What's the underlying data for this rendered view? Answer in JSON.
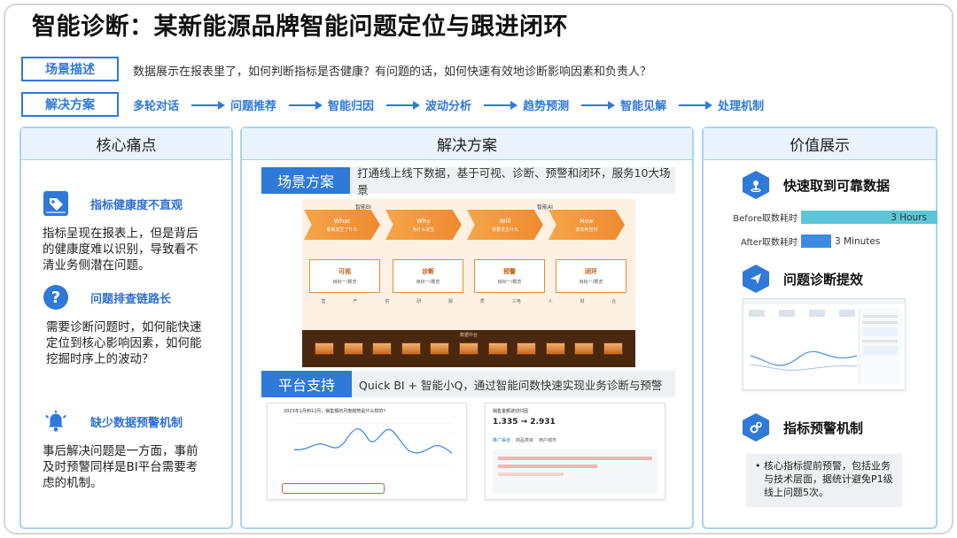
{
  "title": "智能诊断：某新能源品牌智能问题定位与跟进闭环",
  "scene": {
    "label": "场景描述",
    "text": "数据展示在报表里了，如何判断指标是否健康？有问题的话，如何快速有效地诊断影响因素和负责人？"
  },
  "solution_flow": {
    "label": "解决方案",
    "steps": [
      "多轮对话",
      "问题推荐",
      "智能归因",
      "波动分析",
      "趋势预测",
      "智能见解",
      "处理机制"
    ]
  },
  "left_panel": {
    "header": "核心痛点",
    "items": [
      {
        "icon": "tag-icon",
        "title": "指标健康度不直观",
        "desc": "指标呈现在报表上，但是背后的健康度难以识别，导致看不清业务侧潜在问题。"
      },
      {
        "icon": "question-icon",
        "title": "问题排查链路长",
        "desc": "需要诊断问题时，如何能快速定位到核心影响因素，如何能挖掘时序上的波动？"
      },
      {
        "icon": "bell-icon",
        "title": "缺少数据预警机制",
        "desc": "事后解决问题是一方面，事前及时预警同样是BI平台需要考虑的机制。"
      }
    ]
  },
  "middle_panel": {
    "header": "解决方案",
    "scene_band": {
      "label": "场景方案",
      "text": "打通线上线下数据，基于可视、诊断、预警和闭环，服务10大场景"
    },
    "scene_image": {
      "header_left": "智能BI",
      "header_right": "智能AI",
      "chevrons": [
        {
          "title": "What",
          "sub": "看到发生了什么"
        },
        {
          "title": "Why",
          "sub": "为什么发生"
        },
        {
          "title": "Will",
          "sub": "将要发生什么"
        },
        {
          "title": "How",
          "sub": "该如何应对"
        }
      ],
      "boxes": [
        {
          "title": "可视",
          "sub": "目标一/概览"
        },
        {
          "title": "诊断",
          "sub": "目标一/概览"
        },
        {
          "title": "预警",
          "sub": "目标一/概览"
        },
        {
          "title": "闭环",
          "sub": "目标一/概览"
        }
      ],
      "row_labels": [
        "营",
        "产",
        "供",
        "研",
        "服",
        "质",
        "三电",
        "人",
        "财",
        "企"
      ],
      "bottom_label": "数据中台"
    },
    "platform_band": {
      "label": "平台支持",
      "text": "Quick BI + 智能小Q，通过智能问数快速实现业务诊断与预警"
    },
    "shot1": {
      "title": "2023年1月到12月，销售额的月度趋势是什么样的?"
    },
    "shot2": {
      "title": "销售金额波动归因",
      "value_from": "1.335",
      "value_to": "2.931",
      "tabs": [
        "推广渠道",
        "商品类目",
        "用户城市"
      ]
    }
  },
  "right_panel": {
    "header": "价值展示",
    "sections": [
      {
        "icon": "location-icon",
        "title": "快速取到可靠数据"
      },
      {
        "icon": "send-icon",
        "title": "问题诊断提效"
      },
      {
        "icon": "gears-icon",
        "title": "指标预警机制"
      }
    ],
    "metrics": [
      {
        "label": "Before取数耗时",
        "value": "3 Hours",
        "fraction": 1.0,
        "color": "#5cc6d8"
      },
      {
        "label": "After取数耗时",
        "value": "3 Minutes",
        "fraction": 0.22,
        "color": "#3b8de0"
      }
    ],
    "bullet": "核心指标提前预警，包括业务与技术层面，据统计避免P1级线上问题5次。"
  }
}
